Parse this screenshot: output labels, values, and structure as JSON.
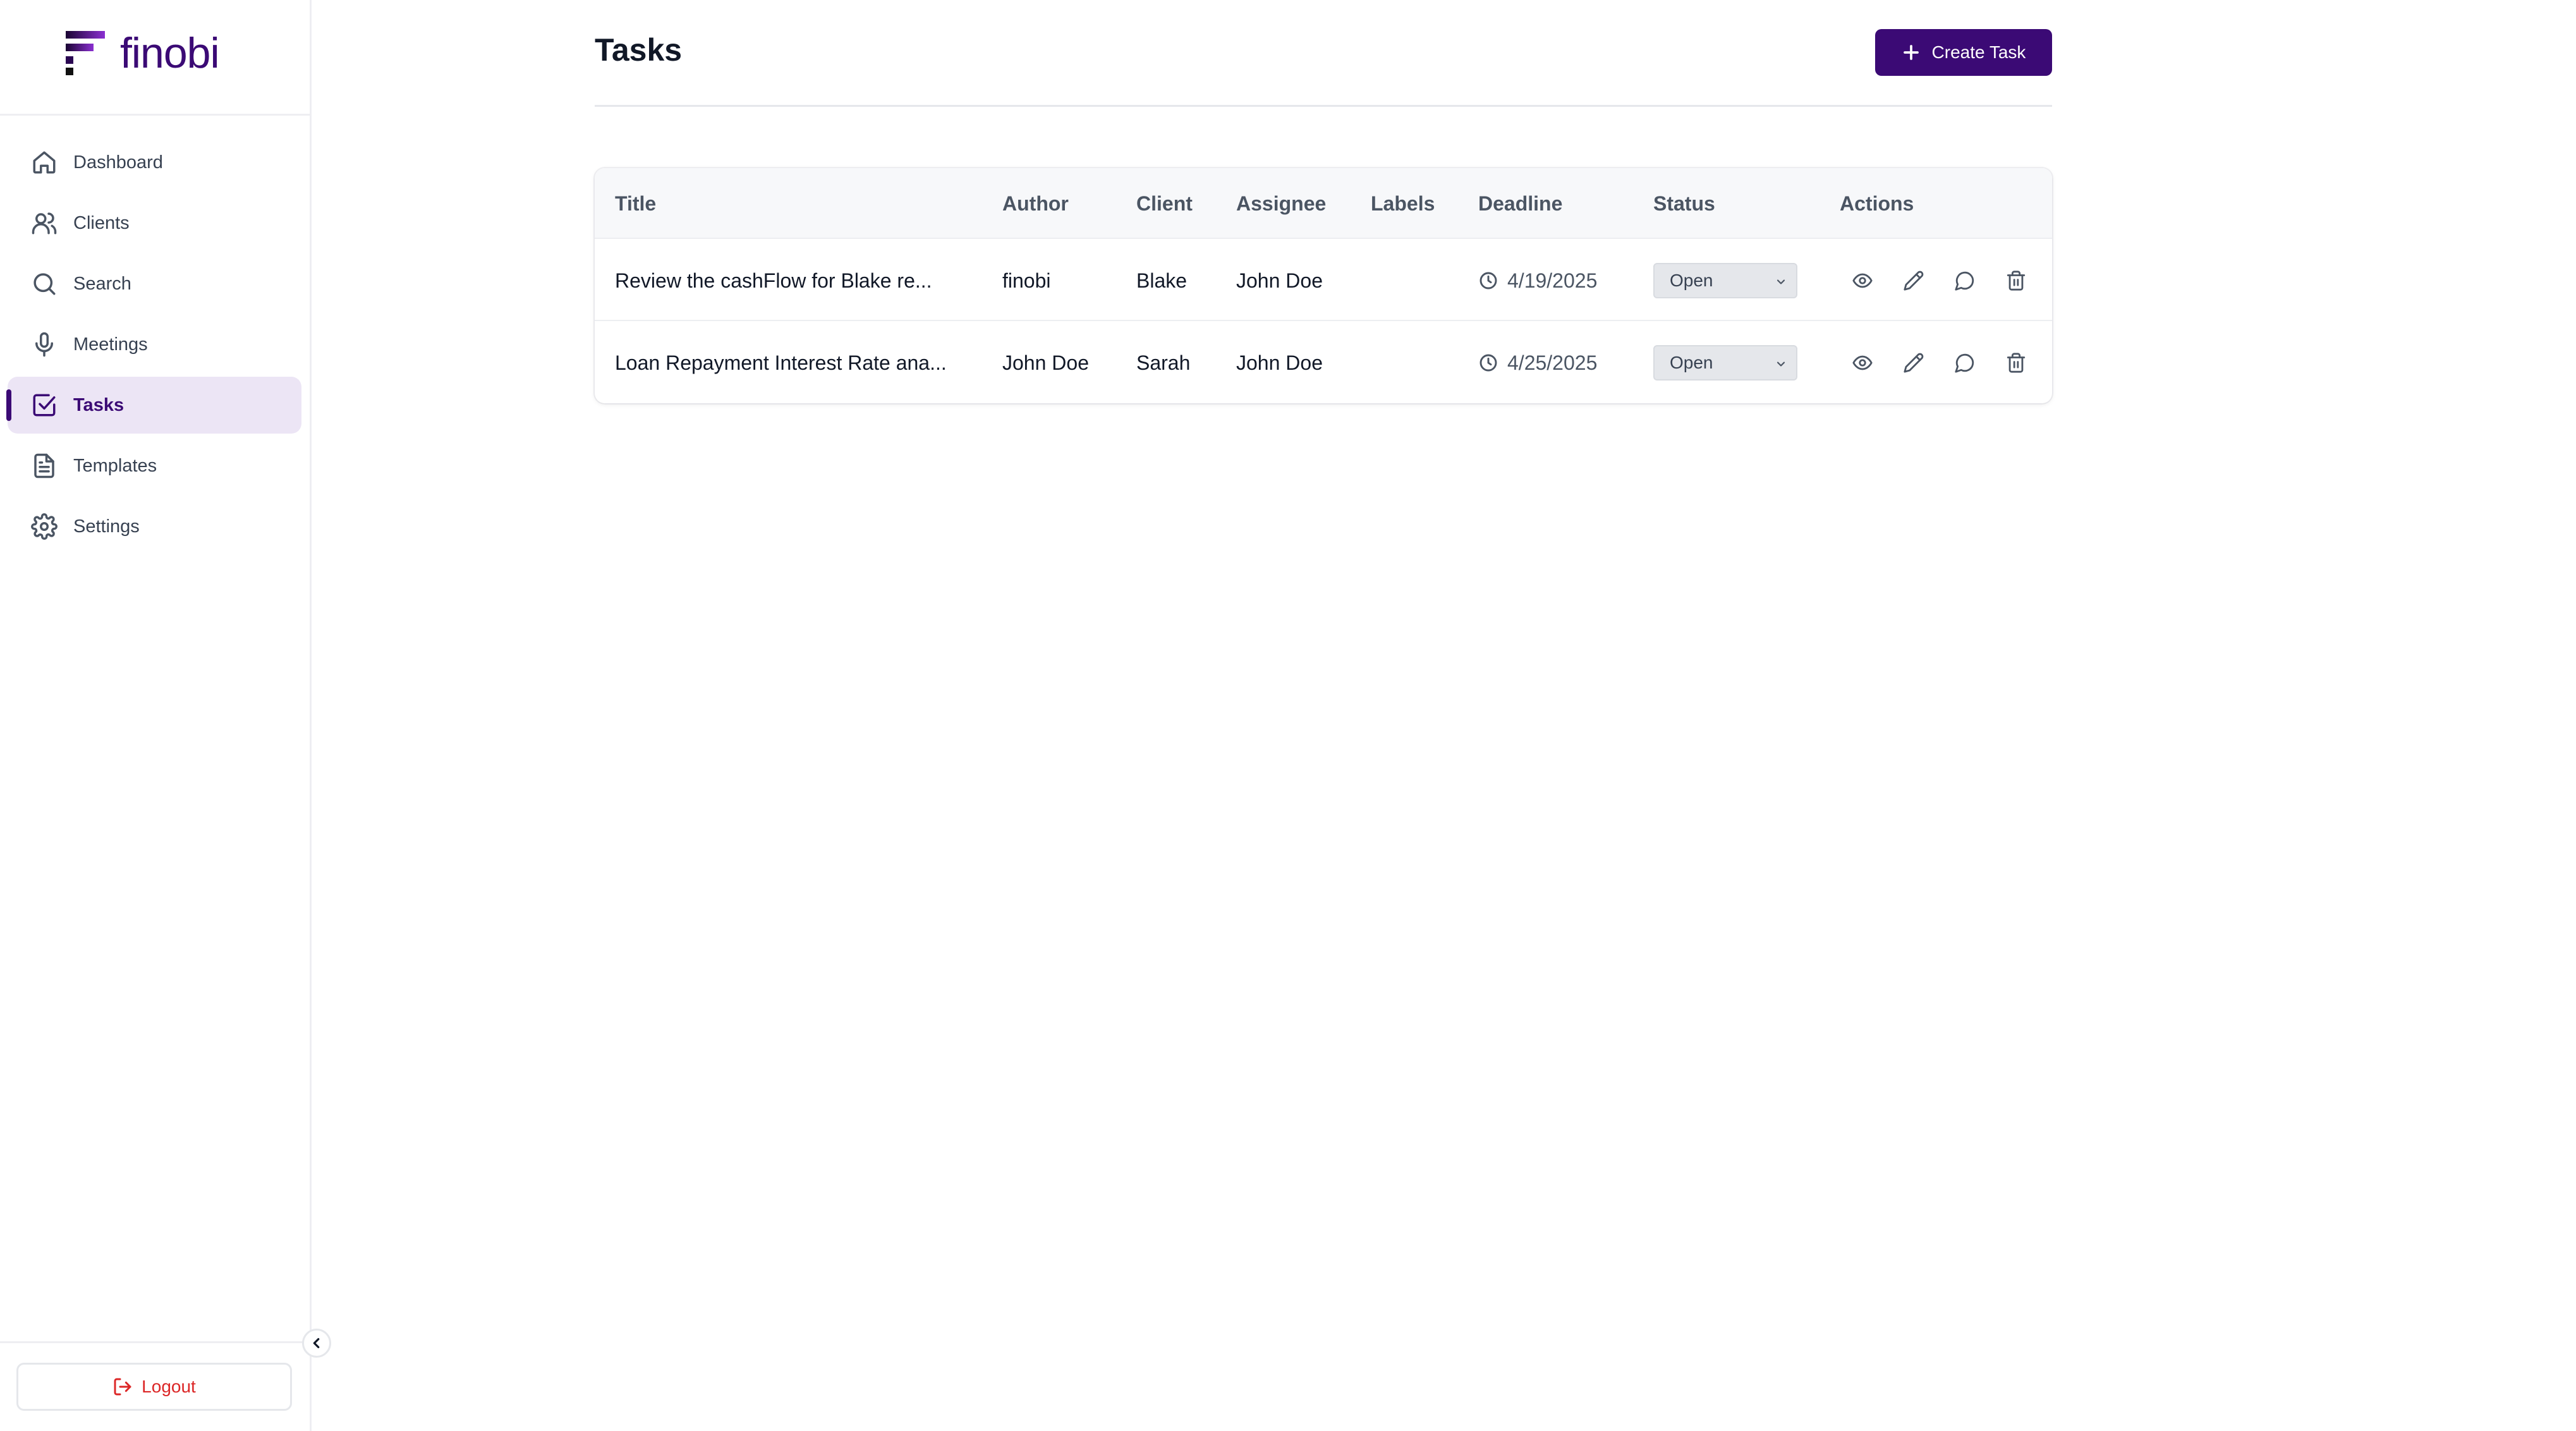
{
  "brand": {
    "name": "finobi",
    "color": "#3b0a75"
  },
  "sidebar": {
    "items": [
      {
        "label": "Dashboard",
        "icon": "home-icon"
      },
      {
        "label": "Clients",
        "icon": "users-icon"
      },
      {
        "label": "Search",
        "icon": "search-icon"
      },
      {
        "label": "Meetings",
        "icon": "microphone-icon"
      },
      {
        "label": "Tasks",
        "icon": "check-square-icon",
        "active": true
      },
      {
        "label": "Templates",
        "icon": "document-icon"
      },
      {
        "label": "Settings",
        "icon": "gear-icon"
      }
    ],
    "logout_label": "Logout"
  },
  "header": {
    "title": "Tasks",
    "create_label": "Create Task"
  },
  "table": {
    "columns": [
      "Title",
      "Author",
      "Client",
      "Assignee",
      "Labels",
      "Deadline",
      "Status",
      "Actions"
    ],
    "rows": [
      {
        "title": "Review the cashFlow for Blake re...",
        "author": "finobi",
        "client": "Blake",
        "assignee": "John Doe",
        "labels": "",
        "deadline": "4/19/2025",
        "status": "Open"
      },
      {
        "title": "Loan Repayment Interest Rate ana...",
        "author": "John Doe",
        "client": "Sarah",
        "assignee": "John Doe",
        "labels": "",
        "deadline": "4/25/2025",
        "status": "Open"
      }
    ]
  }
}
